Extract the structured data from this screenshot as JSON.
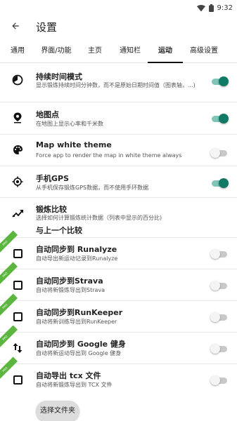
{
  "status_bar": {
    "time": "9:32",
    "wifi_icon": "wifi-icon",
    "battery_icon": "battery-icon"
  },
  "app_bar": {
    "title": "设置",
    "back_icon": "arrow-back-icon"
  },
  "tabs": [
    {
      "label": "通用",
      "active": false
    },
    {
      "label": "界面/功能",
      "active": false
    },
    {
      "label": "主页",
      "active": false
    },
    {
      "label": "通知栏",
      "active": false
    },
    {
      "label": "运动",
      "active": true
    },
    {
      "label": "高级设置",
      "active": false
    }
  ],
  "settings": [
    {
      "icon": "timer-icon",
      "title": "持续时间模式",
      "subtitle": "显示锻炼持续时间分钟数，而不是原始日期时间值（图表轴，...)",
      "toggle": "on"
    },
    {
      "icon": "map-pin-icon",
      "title": "地图点",
      "subtitle": "在地图上显示心率和千米数",
      "toggle": "on"
    },
    {
      "icon": "palette-icon",
      "title": "Map white theme",
      "subtitle": "Force app to render the map in white theme always",
      "toggle": "off"
    },
    {
      "icon": "gps-icon",
      "title": "手机GPS",
      "subtitle": "从手机保存锻炼GPS数据，而不使用手环数据",
      "toggle": "on"
    },
    {
      "icon": "trending-up-icon",
      "title": "锻炼比较",
      "subtitle": "选择如何计算锻炼统计数据（列表中显示的百分比)",
      "extra": "与上一个比较"
    },
    {
      "icon": "checkbox-icon",
      "title": "自动同步到 Runalyze",
      "subtitle": "自动导出新运动记录到Runalyze",
      "toggle": "off",
      "ribbon": "PRO"
    },
    {
      "icon": "checkbox-icon",
      "title": "自动同步到Strava",
      "subtitle": "自动将新锻炼导出到Strava",
      "toggle": "off",
      "ribbon": "PRO"
    },
    {
      "icon": "checkbox-icon",
      "title": "自动同步到RunKeeper",
      "subtitle": "自动将新训练导出到RunKeeper",
      "toggle": "off",
      "ribbon": "PRO"
    },
    {
      "icon": "swap-vertical-icon",
      "title": "自动同步到 Google 健身",
      "subtitle": "自动将新运动导出到 Google 健身",
      "toggle": "off",
      "ribbon": "PRO"
    },
    {
      "icon": "checkbox-icon",
      "title": "自动导出 tcx 文件",
      "subtitle": "自动将新锻炼导出到 TCX 文件",
      "toggle": "off",
      "ribbon": "PRO"
    }
  ],
  "choose_file_button": "选择文件夹"
}
